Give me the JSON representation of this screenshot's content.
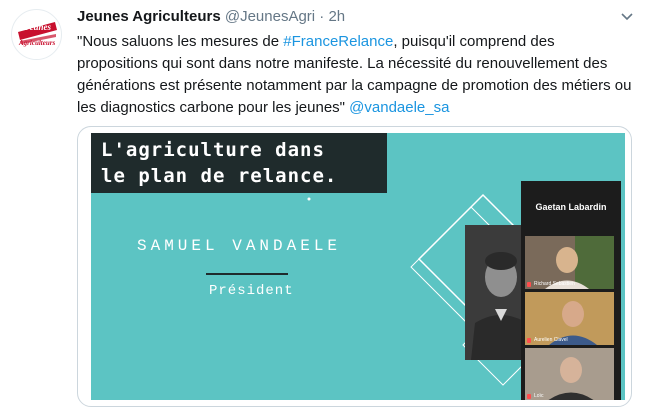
{
  "tweet": {
    "avatar": {
      "logo_line1": "Jeunes",
      "logo_line2": "Agriculteurs",
      "brand_color": "#c8102e"
    },
    "author_name": "Jeunes Agriculteurs",
    "handle": "@JeunesAgri",
    "separator": "·",
    "time": "2h",
    "text": {
      "p1": "\"Nous saluons les mesures de ",
      "hashtag": "#FranceRelance",
      "p2": ", puisqu'il comprend des propositions qui sont dans notre manifeste. La nécessité du renouvellement des générations est présente notamment par la campagne de promotion des métiers ou les diagnostics carbone pour les jeunes\" ",
      "mention": "@vandaele_sa"
    },
    "link_color": "#1b95e0"
  },
  "media": {
    "slide_title_line1": "L'agriculture dans",
    "slide_title_line2": "le plan de relance.",
    "speaker_name": "SAMUEL VANDAELE",
    "speaker_role": "Président",
    "slide_color": "#5cc4c3",
    "video_panel": {
      "title": "Gaetan Labardin",
      "participants": [
        {
          "label": "Richard Sebastien"
        },
        {
          "label": "Aurelien Clavel"
        },
        {
          "label": "Loïc"
        }
      ]
    }
  }
}
